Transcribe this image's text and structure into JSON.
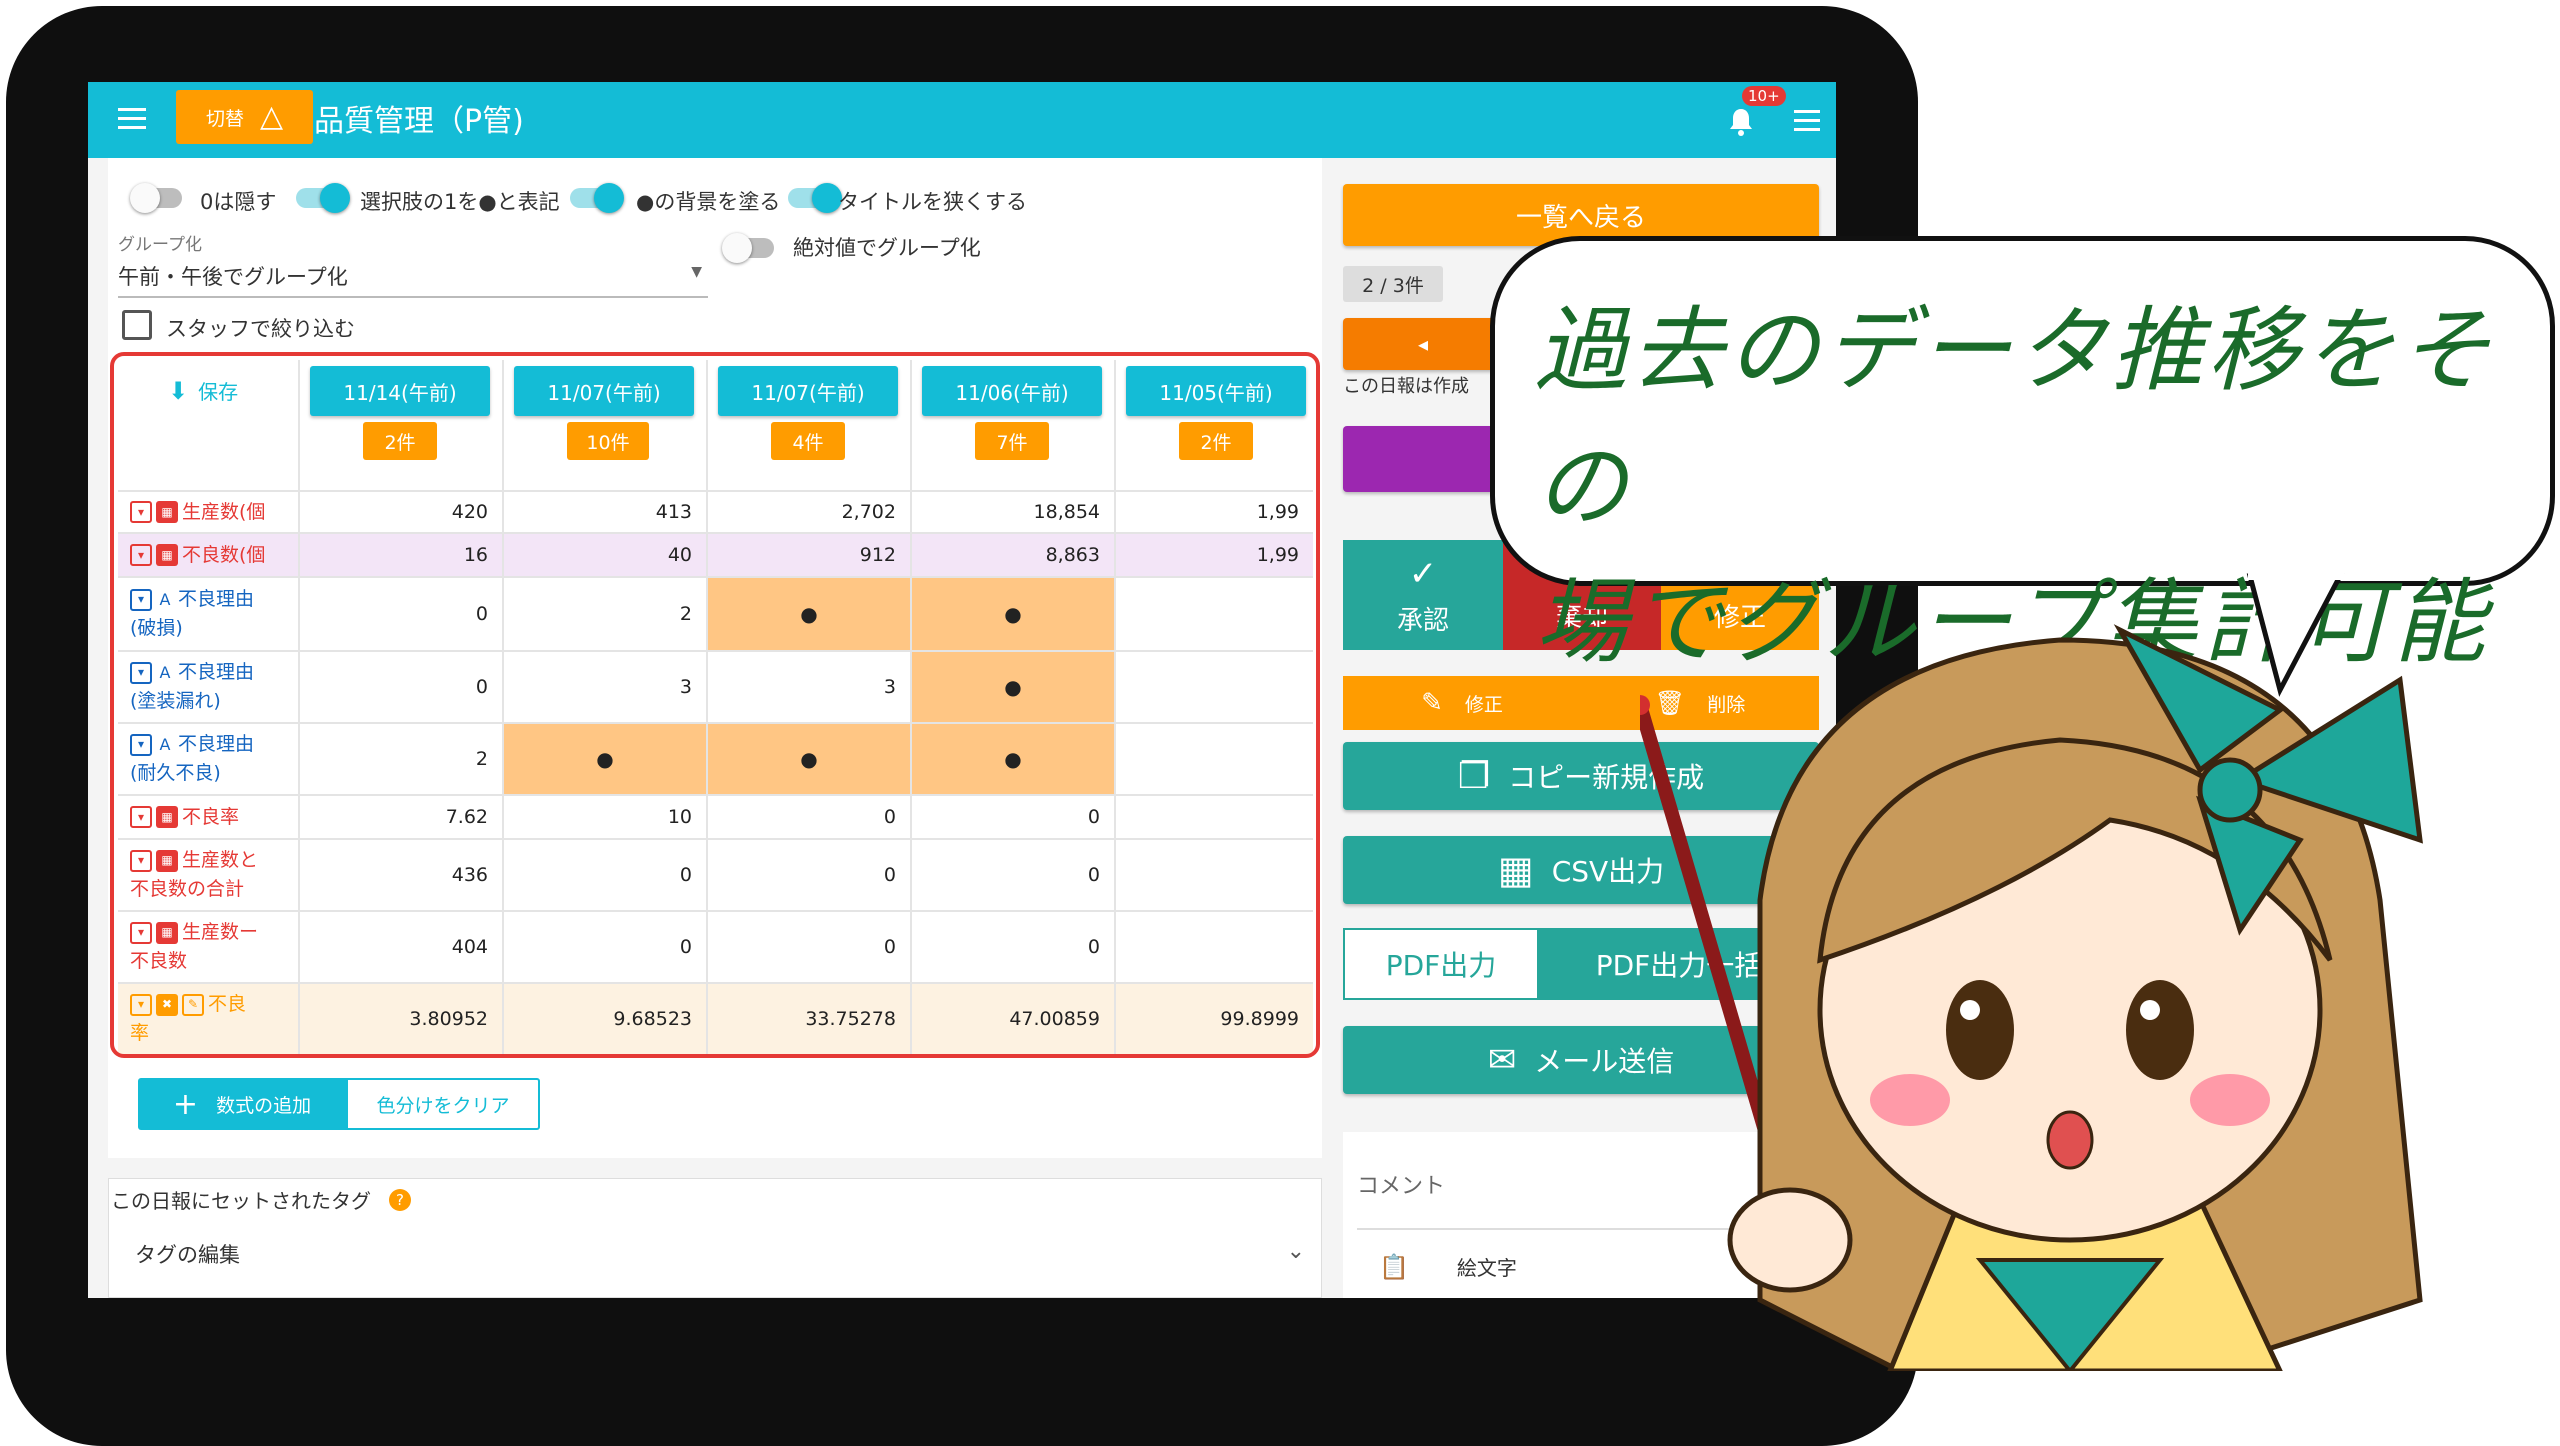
{
  "appbar": {
    "toggle_label": "切替",
    "title": "品質管理（P管)",
    "notification_badge": "10+"
  },
  "settings": {
    "toggles": [
      {
        "label": "0は隠す",
        "on": false
      },
      {
        "label": "選択肢の1を●と表記",
        "on": true
      },
      {
        "label": "●の背景を塗る",
        "on": true
      },
      {
        "label": "タイトルを狭くする",
        "on": true
      }
    ],
    "group_label": "グループ化",
    "group_value": "午前・午後でグループ化",
    "abs_toggle_label": "絶対値でグループ化",
    "staff_filter_label": "スタッフで絞り込む"
  },
  "table": {
    "save_label": "保存",
    "columns": [
      {
        "date": "11/14(午前)",
        "count": "2件"
      },
      {
        "date": "11/07(午前)",
        "count": "10件"
      },
      {
        "date": "11/07(午前)",
        "count": "4件"
      },
      {
        "date": "11/06(午前)",
        "count": "7件"
      },
      {
        "date": "11/05(午前)",
        "count": "2件"
      }
    ],
    "rows": [
      {
        "label": [
          "生産数(個"
        ],
        "values": [
          "420",
          "413",
          "2,702",
          "18,854",
          "1,99"
        ]
      },
      {
        "label": [
          "不良数(個"
        ],
        "values": [
          "16",
          "40",
          "912",
          "8,863",
          "1,99"
        ]
      },
      {
        "label": [
          "不良理由",
          "(破損)"
        ],
        "values": [
          "0",
          "2",
          "●",
          "●",
          ""
        ]
      },
      {
        "label": [
          "不良理由",
          "(塗装漏れ)"
        ],
        "values": [
          "0",
          "3",
          "3",
          "●",
          ""
        ]
      },
      {
        "label": [
          "不良理由",
          "(耐久不良)"
        ],
        "values": [
          "2",
          "●",
          "●",
          "●",
          ""
        ]
      },
      {
        "label": [
          "不良率"
        ],
        "values": [
          "7.62",
          "10",
          "0",
          "0",
          ""
        ]
      },
      {
        "label": [
          "生産数と",
          "不良数の合計"
        ],
        "values": [
          "436",
          "0",
          "0",
          "0",
          ""
        ]
      },
      {
        "label": [
          "生産数ー",
          "不良数"
        ],
        "values": [
          "404",
          "0",
          "0",
          "0",
          ""
        ]
      },
      {
        "label": [
          "不良",
          "率"
        ],
        "values": [
          "3.80952",
          "9.68523",
          "33.75278",
          "47.00859",
          "99.8999"
        ]
      }
    ]
  },
  "formula": {
    "add_label": "数式の追加",
    "clear_label": "色分けをクリア"
  },
  "tags": {
    "title": "この日報にセットされたタグ",
    "edit_label": "タグの編集"
  },
  "right": {
    "back_label": "一覧へ戻る",
    "page_count": "2 / 3件",
    "notice": "この日報は作成",
    "approve_label": "承認",
    "reject_label": "棄却",
    "fix_label": "修正",
    "edit_label": "修正",
    "delete_label": "削除",
    "copy_label": "コピー新規作成",
    "csv_label": "CSV出力",
    "pdf_label": "PDF出力",
    "pdf_bulk_label": "PDF出力一括",
    "mail_label": "メール送信",
    "comment_label": "コメント",
    "emoji_label": "絵文字"
  },
  "callout": {
    "line1": "過去のデータ推移をその",
    "line2": "場でグループ集計可能"
  }
}
